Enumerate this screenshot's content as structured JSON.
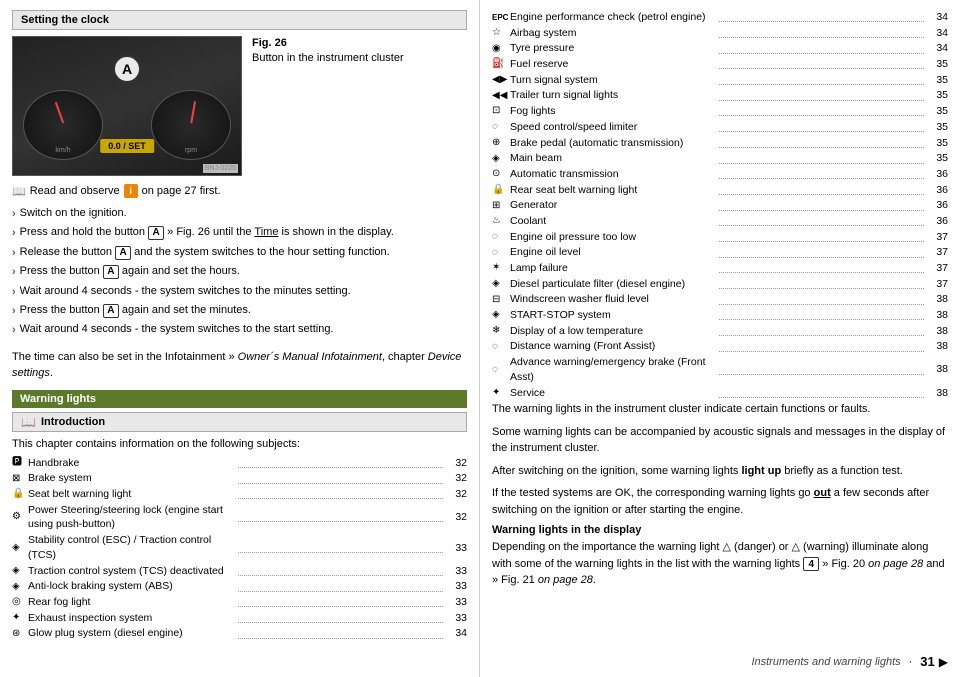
{
  "left": {
    "section_title": "Setting the clock",
    "fig_num": "Fig. 26",
    "fig_caption": "Button in the instrument cluster",
    "display_text": "0.0 / SET",
    "bnj_label": "BNJ-0225",
    "read_observe": "Read and observe",
    "page_ref": "on page 27 first.",
    "instructions": [
      "Switch on the ignition.",
      "Press and hold the button A » Fig. 26 until the Time is shown in the display.",
      "Release the button A and the system switches to the hour setting function.",
      "Press the button A again and set the hours.",
      "Wait around 4 seconds - the system switches to the minutes setting.",
      "Press the button A again and set the minutes.",
      "Wait around 4 seconds - the system switches to the start setting."
    ],
    "info_para": "The time can also be set in the Infotainment » Owner´s Manual Infotainment, chapter Device settings.",
    "warning_section": "Warning lights",
    "intro_label": "Introduction",
    "intro_text": "This chapter contains information on the following subjects:",
    "toc_items": [
      {
        "icon": "🅿",
        "label": "Handbrake",
        "page": "32"
      },
      {
        "icon": "⊠",
        "label": "Brake system",
        "page": "32"
      },
      {
        "icon": "🔒",
        "label": "Seat belt warning light",
        "page": "32"
      },
      {
        "icon": "⚙",
        "label": "Power Steering/steering lock (engine start using push-button)",
        "page": "32"
      },
      {
        "icon": "◈",
        "label": "Stability control (ESC) / Traction control (TCS)",
        "page": "33"
      },
      {
        "icon": "◈",
        "label": "Traction control system (TCS) deactivated",
        "page": "33"
      },
      {
        "icon": "◈",
        "label": "Anti-lock braking system (ABS)",
        "page": "33"
      },
      {
        "icon": "◎",
        "label": "Rear fog light",
        "page": "33"
      },
      {
        "icon": "✦",
        "label": "Exhaust inspection system",
        "page": "33"
      },
      {
        "icon": "⊛",
        "label": "Glow plug system (diesel engine)",
        "page": "34"
      }
    ]
  },
  "right": {
    "toc_items": [
      {
        "icon": "EPC",
        "label": "Engine performance check (petrol engine)",
        "page": "34"
      },
      {
        "icon": "☆",
        "label": "Airbag system",
        "page": "34"
      },
      {
        "icon": "◉",
        "label": "Tyre pressure",
        "page": "34"
      },
      {
        "icon": "⛽",
        "label": "Fuel reserve",
        "page": "35"
      },
      {
        "icon": "◀▶",
        "label": "Turn signal system",
        "page": "35"
      },
      {
        "icon": "◀◀",
        "label": "Trailer turn signal lights",
        "page": "35"
      },
      {
        "icon": "⊡",
        "label": "Fog lights",
        "page": "35"
      },
      {
        "icon": "◌",
        "label": "Speed control/speed limiter",
        "page": "35"
      },
      {
        "icon": "⊕",
        "label": "Brake pedal (automatic transmission)",
        "page": "35"
      },
      {
        "icon": "◈",
        "label": "Main beam",
        "page": "35"
      },
      {
        "icon": "⊙",
        "label": "Automatic transmission",
        "page": "36"
      },
      {
        "icon": "🔒",
        "label": "Rear seat belt warning light",
        "page": "36"
      },
      {
        "icon": "⊞",
        "label": "Generator",
        "page": "36"
      },
      {
        "icon": "♨",
        "label": "Coolant",
        "page": "36"
      },
      {
        "icon": "◌",
        "label": "Engine oil pressure too low",
        "page": "37"
      },
      {
        "icon": "◌",
        "label": "Engine oil level",
        "page": "37"
      },
      {
        "icon": "✶",
        "label": "Lamp failure",
        "page": "37"
      },
      {
        "icon": "◈",
        "label": "Diesel particulate filter (diesel engine)",
        "page": "37"
      },
      {
        "icon": "⊟",
        "label": "Windscreen washer fluid level",
        "page": "38"
      },
      {
        "icon": "◈",
        "label": "START-STOP system",
        "page": "38"
      },
      {
        "icon": "❄",
        "label": "Display of a low temperature",
        "page": "38"
      },
      {
        "icon": "◌",
        "label": "Distance warning (Front Assist)",
        "page": "38"
      },
      {
        "icon": "◌",
        "label": "Advance warning/emergency brake (Front Asst)",
        "page": "38"
      },
      {
        "icon": "✦",
        "label": "Service",
        "page": "38"
      }
    ],
    "warning_paras": [
      "The warning lights in the instrument cluster indicate certain functions or faults.",
      "Some warning lights can be accompanied by acoustic signals and messages in the display of the instrument cluster.",
      "After switching on the ignition, some warning lights light up briefly as a function test.",
      "If the tested systems are OK, the corresponding warning lights go out a few seconds after switching on the ignition or after starting the engine."
    ],
    "warning_in_display_header": "Warning lights in the display",
    "warning_in_display_text": "Depending on the importance the warning light (danger) or (warning) illuminate along with some of the warning lights in the list with the warning lights 4 » Fig. 20 on page 28 and » Fig. 21 on page 28.",
    "footer_label": "Instruments and warning lights",
    "footer_page": "31"
  }
}
